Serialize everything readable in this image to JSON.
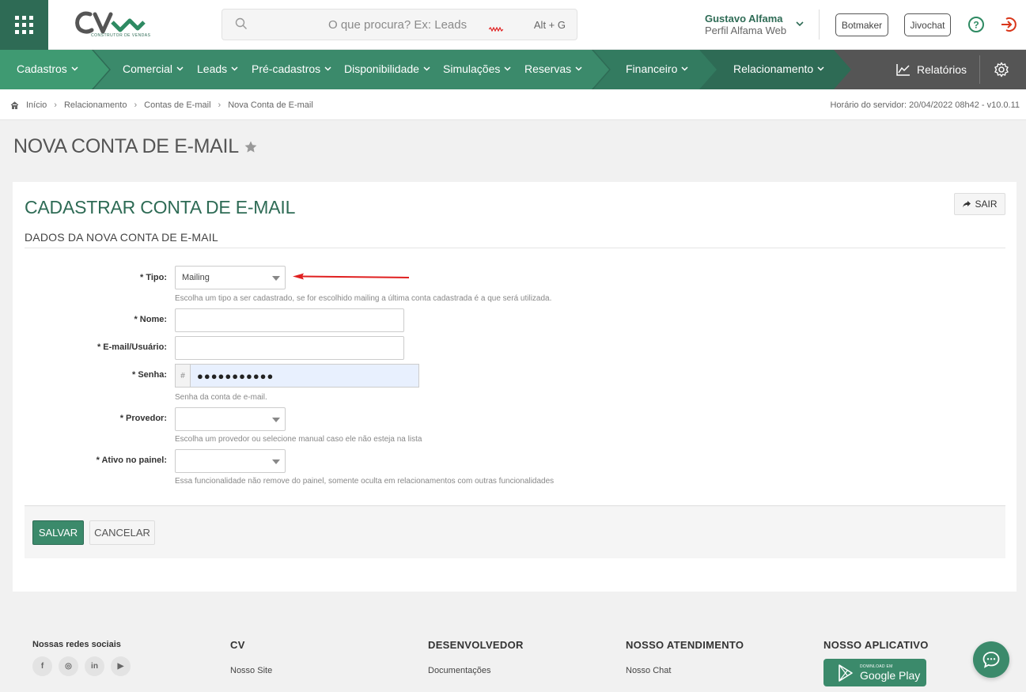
{
  "header": {
    "logo_text": "CONSTRUTOR DE VENDAS",
    "search_placeholder": "O que procura? Ex: Leads",
    "search_shortcut": "Alt + G",
    "user_name": "Gustavo Alfama",
    "user_profile": "Perfil Alfama Web",
    "botmaker_label": "Botmaker",
    "jivochat_label": "Jivochat"
  },
  "nav": {
    "items": [
      "Cadastros",
      "Comercial",
      "Leads",
      "Pré-cadastros",
      "Disponibilidade",
      "Simulações",
      "Reservas",
      "Financeiro",
      "Relacionamento"
    ],
    "reports_label": "Relatórios"
  },
  "breadcrumb": {
    "items": [
      "Início",
      "Relacionamento",
      "Contas de E-mail",
      "Nova Conta de E-mail"
    ],
    "server_time": "Horário do servidor: 20/04/2022 08h42 - v10.0.11"
  },
  "page_title": "NOVA CONTA DE E-MAIL",
  "card": {
    "title": "CADASTRAR CONTA DE E-MAIL",
    "exit_label": "SAIR",
    "section_title": "DADOS DA NOVA CONTA DE E-MAIL"
  },
  "form": {
    "tipo_label": "* Tipo:",
    "tipo_value": "Mailing",
    "tipo_help": "Escolha um tipo a ser cadastrado, se for escolhido mailing a última conta cadastrada é a que será utilizada.",
    "nome_label": "* Nome:",
    "nome_value": "",
    "email_label": "* E-mail/Usuário:",
    "email_value": "",
    "senha_label": "* Senha:",
    "senha_addon": "#",
    "senha_value": "●●●●●●●●●●●",
    "senha_help": "Senha da conta de e-mail.",
    "provedor_label": "* Provedor:",
    "provedor_value": "",
    "provedor_help": "Escolha um provedor ou selecione manual caso ele não esteja na lista",
    "ativo_label": "* Ativo no painel:",
    "ativo_value": "",
    "ativo_help": "Essa funcionalidade não remove do painel, somente oculta em relacionamentos com outras funcionalidades",
    "save_label": "SALVAR",
    "cancel_label": "CANCELAR"
  },
  "footer": {
    "social_title": "Nossas redes sociais",
    "social_icons": [
      "f",
      "◎",
      "in",
      "▶"
    ],
    "cols": [
      {
        "title": "CV",
        "link": "Nosso Site"
      },
      {
        "title": "DESENVOLVEDOR",
        "link": "Documentações"
      },
      {
        "title": "NOSSO ATENDIMENTO",
        "link": "Nosso Chat"
      },
      {
        "title": "NOSSO APLICATIVO",
        "link": ""
      }
    ],
    "gplay_small": "DOWNLOAD EM",
    "gplay_big": "Google Play"
  },
  "colors": {
    "brand_green": "#2e6b55",
    "accent_green": "#3b8a6b",
    "arrow_red": "#e02020"
  }
}
